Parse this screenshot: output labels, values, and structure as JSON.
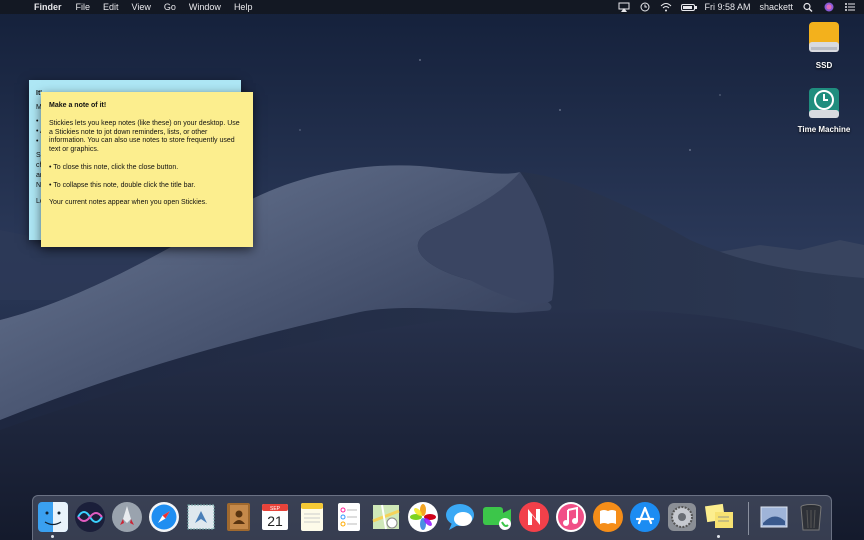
{
  "menubar": {
    "apple_glyph": "",
    "app_name": "Finder",
    "menus": [
      "File",
      "Edit",
      "View",
      "Go",
      "Window",
      "Help"
    ],
    "clock": "Fri 9:58 AM",
    "user": "shackett",
    "icons": [
      "airplay-icon",
      "time-machine-icon",
      "wifi-icon",
      "battery-icon",
      "search-icon",
      "siri-icon",
      "notification-center-icon"
    ]
  },
  "desktop_icons": [
    {
      "name": "SSD",
      "icon": "external-drive-icon"
    },
    {
      "name": "Time Machine",
      "icon": "time-machine-drive-icon"
    }
  ],
  "stickies": {
    "back_note_fragments": [
      "It'",
      "M",
      "• ",
      "• A",
      "• ",
      "Sl",
      "ch",
      "ar",
      "Ni",
      "Lo"
    ],
    "front_note": {
      "title": "Make a note of it!",
      "paragraphs": [
        "Stickies lets you keep notes (like these) on your desktop. Use a Stickies note to jot down reminders, lists, or other information. You can also use notes to store frequently used text or graphics.",
        "• To close this note, click the close button.",
        "• To collapse this note, double click the title bar.",
        "Your current notes appear when you open Stickies."
      ]
    }
  },
  "dock": {
    "items": [
      {
        "name": "Finder",
        "icon": "finder-icon",
        "running": true
      },
      {
        "name": "Siri",
        "icon": "siri-icon",
        "running": false
      },
      {
        "name": "Launchpad",
        "icon": "launchpad-icon",
        "running": false
      },
      {
        "name": "Safari",
        "icon": "safari-icon",
        "running": false
      },
      {
        "name": "Mail",
        "icon": "mail-icon",
        "running": false
      },
      {
        "name": "Contacts",
        "icon": "contacts-icon",
        "running": false
      },
      {
        "name": "Calendar",
        "icon": "calendar-icon",
        "running": false,
        "month": "SEP",
        "day": "21"
      },
      {
        "name": "Notes",
        "icon": "notes-icon",
        "running": false
      },
      {
        "name": "Reminders",
        "icon": "reminders-icon",
        "running": false
      },
      {
        "name": "Maps",
        "icon": "maps-icon",
        "running": false
      },
      {
        "name": "Photos",
        "icon": "photos-icon",
        "running": false
      },
      {
        "name": "Messages",
        "icon": "messages-icon",
        "running": false
      },
      {
        "name": "FaceTime",
        "icon": "facetime-icon",
        "running": false
      },
      {
        "name": "News",
        "icon": "news-icon",
        "running": false
      },
      {
        "name": "iTunes",
        "icon": "itunes-icon",
        "running": false
      },
      {
        "name": "Books",
        "icon": "books-icon",
        "running": false
      },
      {
        "name": "App Store",
        "icon": "app-store-icon",
        "running": false
      },
      {
        "name": "System Preferences",
        "icon": "system-preferences-icon",
        "running": false
      },
      {
        "name": "Stickies",
        "icon": "stickies-icon",
        "running": true
      }
    ],
    "right_items": [
      {
        "name": "Downloads",
        "icon": "downloads-stack-icon"
      },
      {
        "name": "Trash",
        "icon": "trash-icon"
      }
    ]
  },
  "colors": {
    "sky": "#1e2a42",
    "dune": "#4b5670",
    "sticky_yellow": "#fcee8e",
    "sticky_blue": "#aee7f5"
  }
}
